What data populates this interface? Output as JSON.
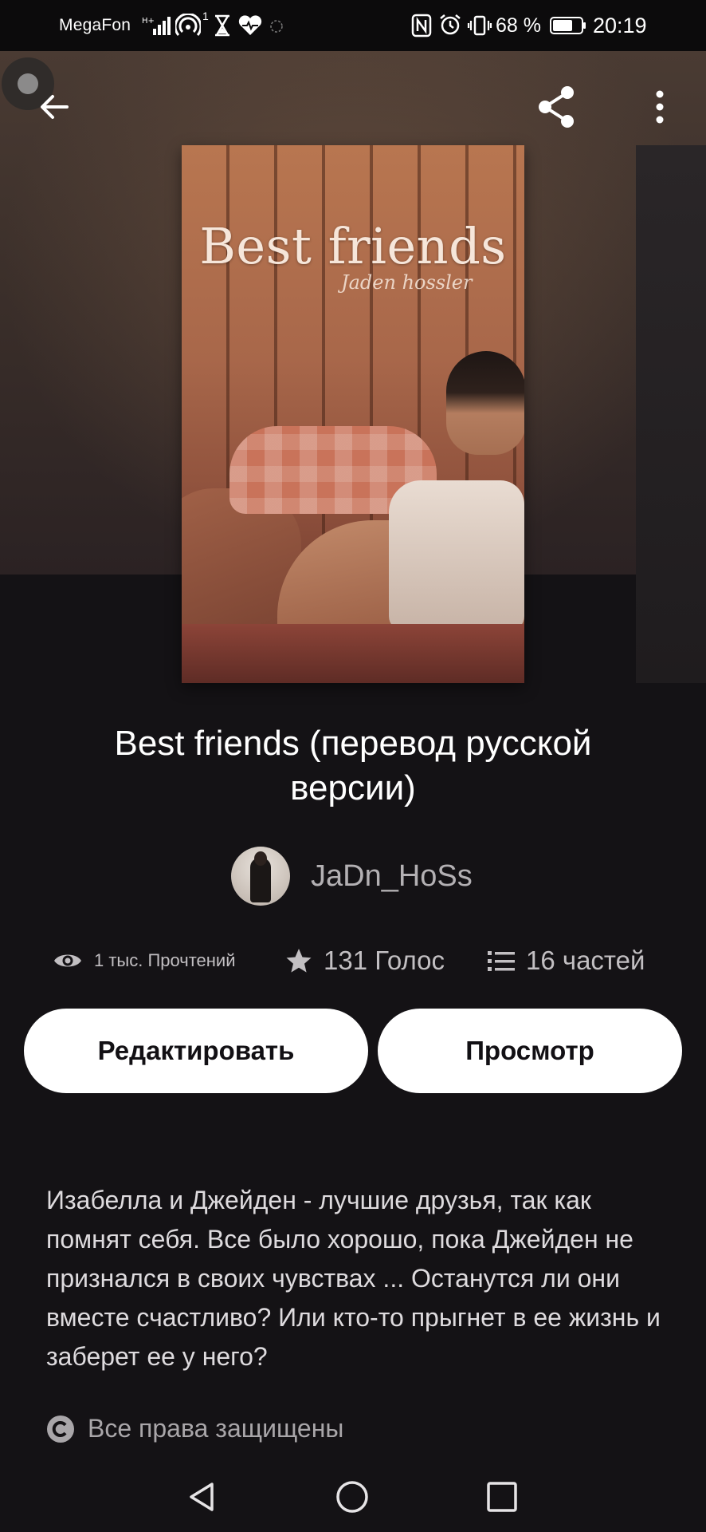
{
  "status_bar": {
    "carrier": "MegaFon",
    "hotspot_count": "1",
    "battery_percent": "68 %",
    "time": "20:19"
  },
  "story": {
    "cover_title": "Best friends",
    "cover_subtitle": "Jaden hossler",
    "title": "Best friends (перевод русской версии)",
    "author": "JaDn_HoSs",
    "stats": {
      "reads": "1 тыс. Прочтений",
      "votes": "131 Голос",
      "parts": "16 частей"
    },
    "description": "Изабелла и Джейден - лучшие друзья, так как помнят себя.  Все было хорошо, пока Джейден не признался в своих чувствах ... Останутся ли они вместе счастливо?  Или кто-то прыгнет в ее жизнь и заберет ее у него?",
    "copyright": "Все права защищены"
  },
  "actions": {
    "edit_label": "Редактировать",
    "preview_label": "Просмотр"
  },
  "icons": {
    "back": "arrow-left-icon",
    "share": "share-icon",
    "more": "more-vertical-icon",
    "reads": "eye-icon",
    "votes": "star-icon",
    "parts": "list-icon",
    "copyright": "copyright-icon"
  },
  "colors": {
    "background": "#141215",
    "button_bg": "#ffffff",
    "button_text": "#121014",
    "secondary_text": "#c2bfc2"
  }
}
